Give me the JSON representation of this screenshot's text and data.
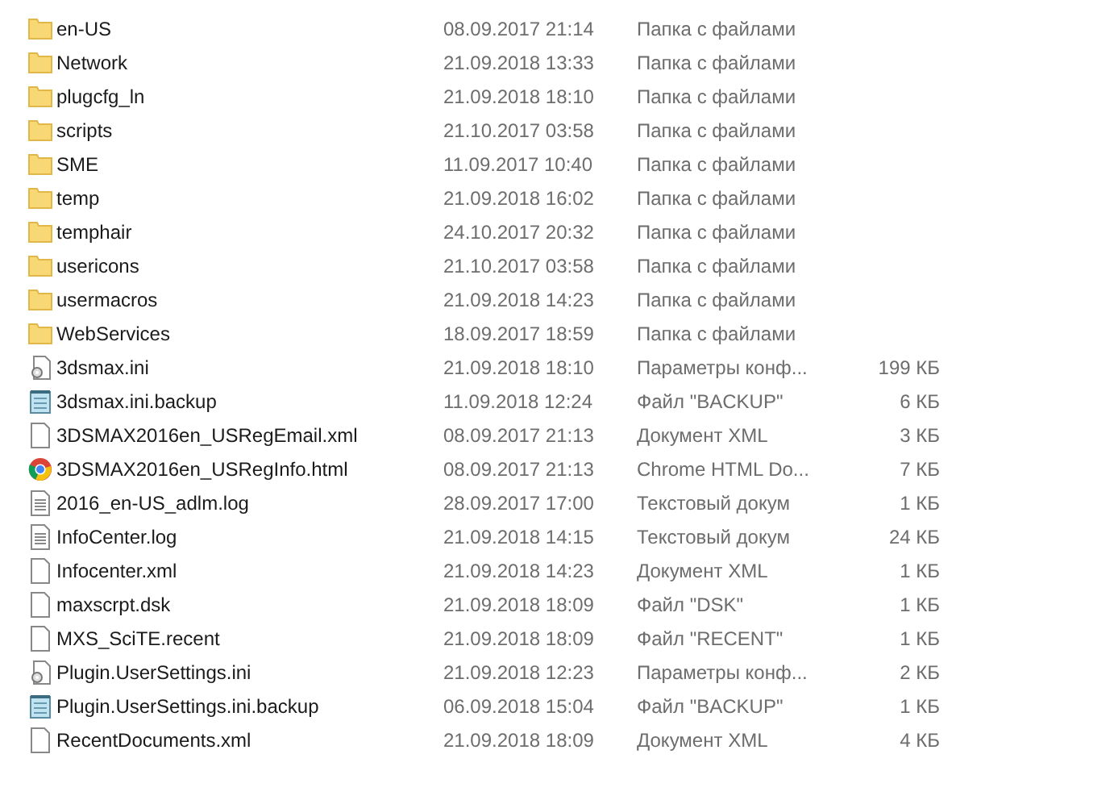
{
  "files": [
    {
      "kind": "folder",
      "name": "en-US",
      "date": "08.09.2017 21:14",
      "type": "Папка с файлами"
    },
    {
      "kind": "folder",
      "name": "Network",
      "date": "21.09.2018 13:33",
      "type": "Папка с файлами"
    },
    {
      "kind": "folder",
      "name": "plugcfg_ln",
      "date": "21.09.2018 18:10",
      "type": "Папка с файлами"
    },
    {
      "kind": "folder",
      "name": "scripts",
      "date": "21.10.2017 03:58",
      "type": "Папка с файлами"
    },
    {
      "kind": "folder",
      "name": "SME",
      "date": "11.09.2017 10:40",
      "type": "Папка с файлами"
    },
    {
      "kind": "folder",
      "name": "temp",
      "date": "21.09.2018 16:02",
      "type": "Папка с файлами"
    },
    {
      "kind": "folder",
      "name": "temphair",
      "date": "24.10.2017 20:32",
      "type": "Папка с файлами"
    },
    {
      "kind": "folder",
      "name": "usericons",
      "date": "21.10.2017 03:58",
      "type": "Папка с файлами"
    },
    {
      "kind": "folder",
      "name": "usermacros",
      "date": "21.09.2018 14:23",
      "type": "Папка с файлами"
    },
    {
      "kind": "folder",
      "name": "WebServices",
      "date": "18.09.2017 18:59",
      "type": "Папка с файлами"
    },
    {
      "kind": "settings",
      "name": "3dsmax.ini",
      "date": "21.09.2018 18:10",
      "type": "Параметры конф...",
      "size": "199 КБ"
    },
    {
      "kind": "notepad",
      "name": "3dsmax.ini.backup",
      "date": "11.09.2018 12:24",
      "type": "Файл \"BACKUP\"",
      "size": "6 КБ"
    },
    {
      "kind": "blank",
      "name": "3DSMAX2016en_USRegEmail.xml",
      "date": "08.09.2017 21:13",
      "type": "Документ XML",
      "size": "3 КБ"
    },
    {
      "kind": "browser",
      "name": "3DSMAX2016en_USRegInfo.html",
      "date": "08.09.2017 21:13",
      "type": "Chrome HTML Do...",
      "size": "7 КБ"
    },
    {
      "kind": "text",
      "name": "2016_en-US_adlm.log",
      "date": "28.09.2017 17:00",
      "type": "Текстовый докум",
      "size": "1 КБ"
    },
    {
      "kind": "text",
      "name": "InfoCenter.log",
      "date": "21.09.2018 14:15",
      "type": "Текстовый докум",
      "size": "24 КБ"
    },
    {
      "kind": "blank",
      "name": "Infocenter.xml",
      "date": "21.09.2018 14:23",
      "type": "Документ XML",
      "size": "1 КБ"
    },
    {
      "kind": "blank",
      "name": "maxscrpt.dsk",
      "date": "21.09.2018 18:09",
      "type": "Файл \"DSK\"",
      "size": "1 КБ"
    },
    {
      "kind": "blank",
      "name": "MXS_SciTE.recent",
      "date": "21.09.2018 18:09",
      "type": "Файл \"RECENT\"",
      "size": "1 КБ"
    },
    {
      "kind": "settings",
      "name": "Plugin.UserSettings.ini",
      "date": "21.09.2018 12:23",
      "type": "Параметры конф...",
      "size": "2 КБ"
    },
    {
      "kind": "notepad",
      "name": "Plugin.UserSettings.ini.backup",
      "date": "06.09.2018 15:04",
      "type": "Файл \"BACKUP\"",
      "size": "1 КБ"
    },
    {
      "kind": "blank",
      "name": "RecentDocuments.xml",
      "date": "21.09.2018 18:09",
      "type": "Документ XML",
      "size": "4 КБ"
    }
  ]
}
